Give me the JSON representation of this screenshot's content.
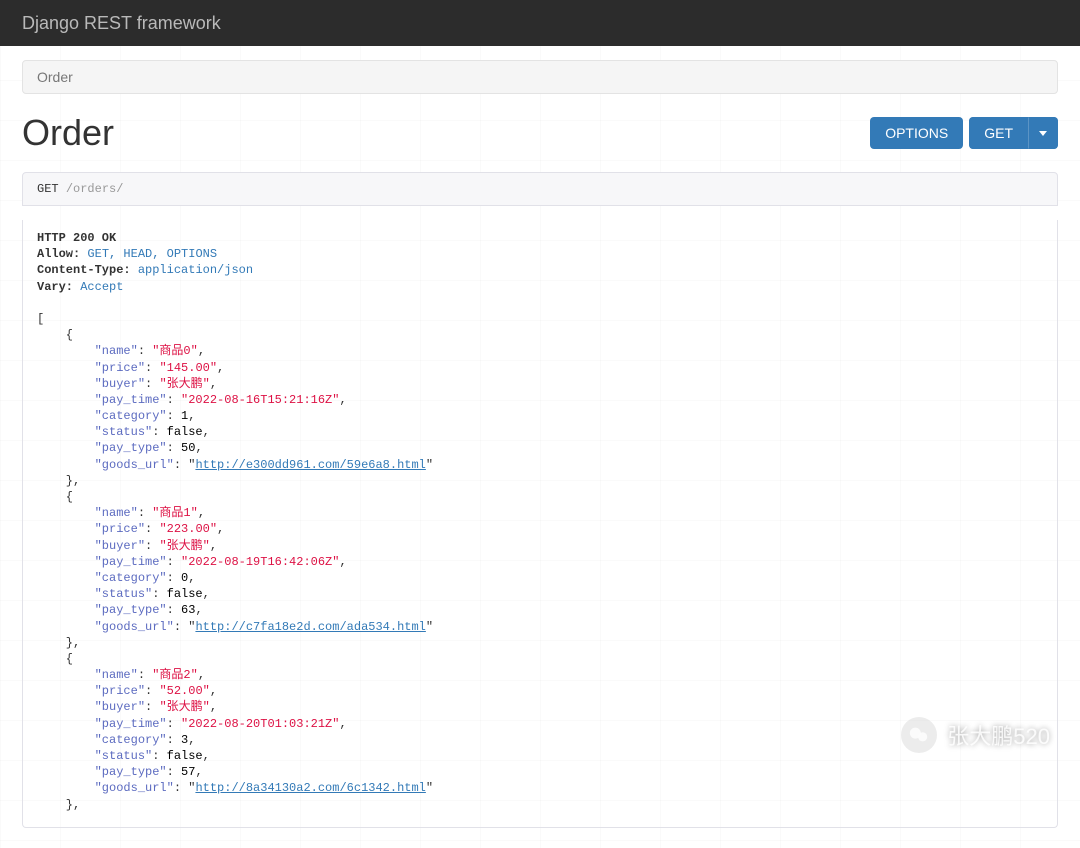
{
  "brand": "Django REST framework",
  "breadcrumb": "Order",
  "page_title": "Order",
  "buttons": {
    "options": "OPTIONS",
    "get": "GET"
  },
  "request": {
    "method": "GET",
    "path": "/orders/"
  },
  "response_headers": {
    "status_line": "HTTP 200 OK",
    "allow_label": "Allow:",
    "allow_value": "GET, HEAD, OPTIONS",
    "ctype_label": "Content-Type:",
    "ctype_value": "application/json",
    "vary_label": "Vary:",
    "vary_value": "Accept"
  },
  "orders": [
    {
      "name": "商品0",
      "price": "145.00",
      "buyer": "张大鹏",
      "pay_time": "2022-08-16T15:21:16Z",
      "category": 1,
      "status": false,
      "pay_type": 50,
      "goods_url": "http://e300dd961.com/59e6a8.html"
    },
    {
      "name": "商品1",
      "price": "223.00",
      "buyer": "张大鹏",
      "pay_time": "2022-08-19T16:42:06Z",
      "category": 0,
      "status": false,
      "pay_type": 63,
      "goods_url": "http://c7fa18e2d.com/ada534.html"
    },
    {
      "name": "商品2",
      "price": "52.00",
      "buyer": "张大鹏",
      "pay_time": "2022-08-20T01:03:21Z",
      "category": 3,
      "status": false,
      "pay_type": 57,
      "goods_url": "http://8a34130a2.com/6c1342.html"
    }
  ],
  "watermark": "张大鹏520"
}
